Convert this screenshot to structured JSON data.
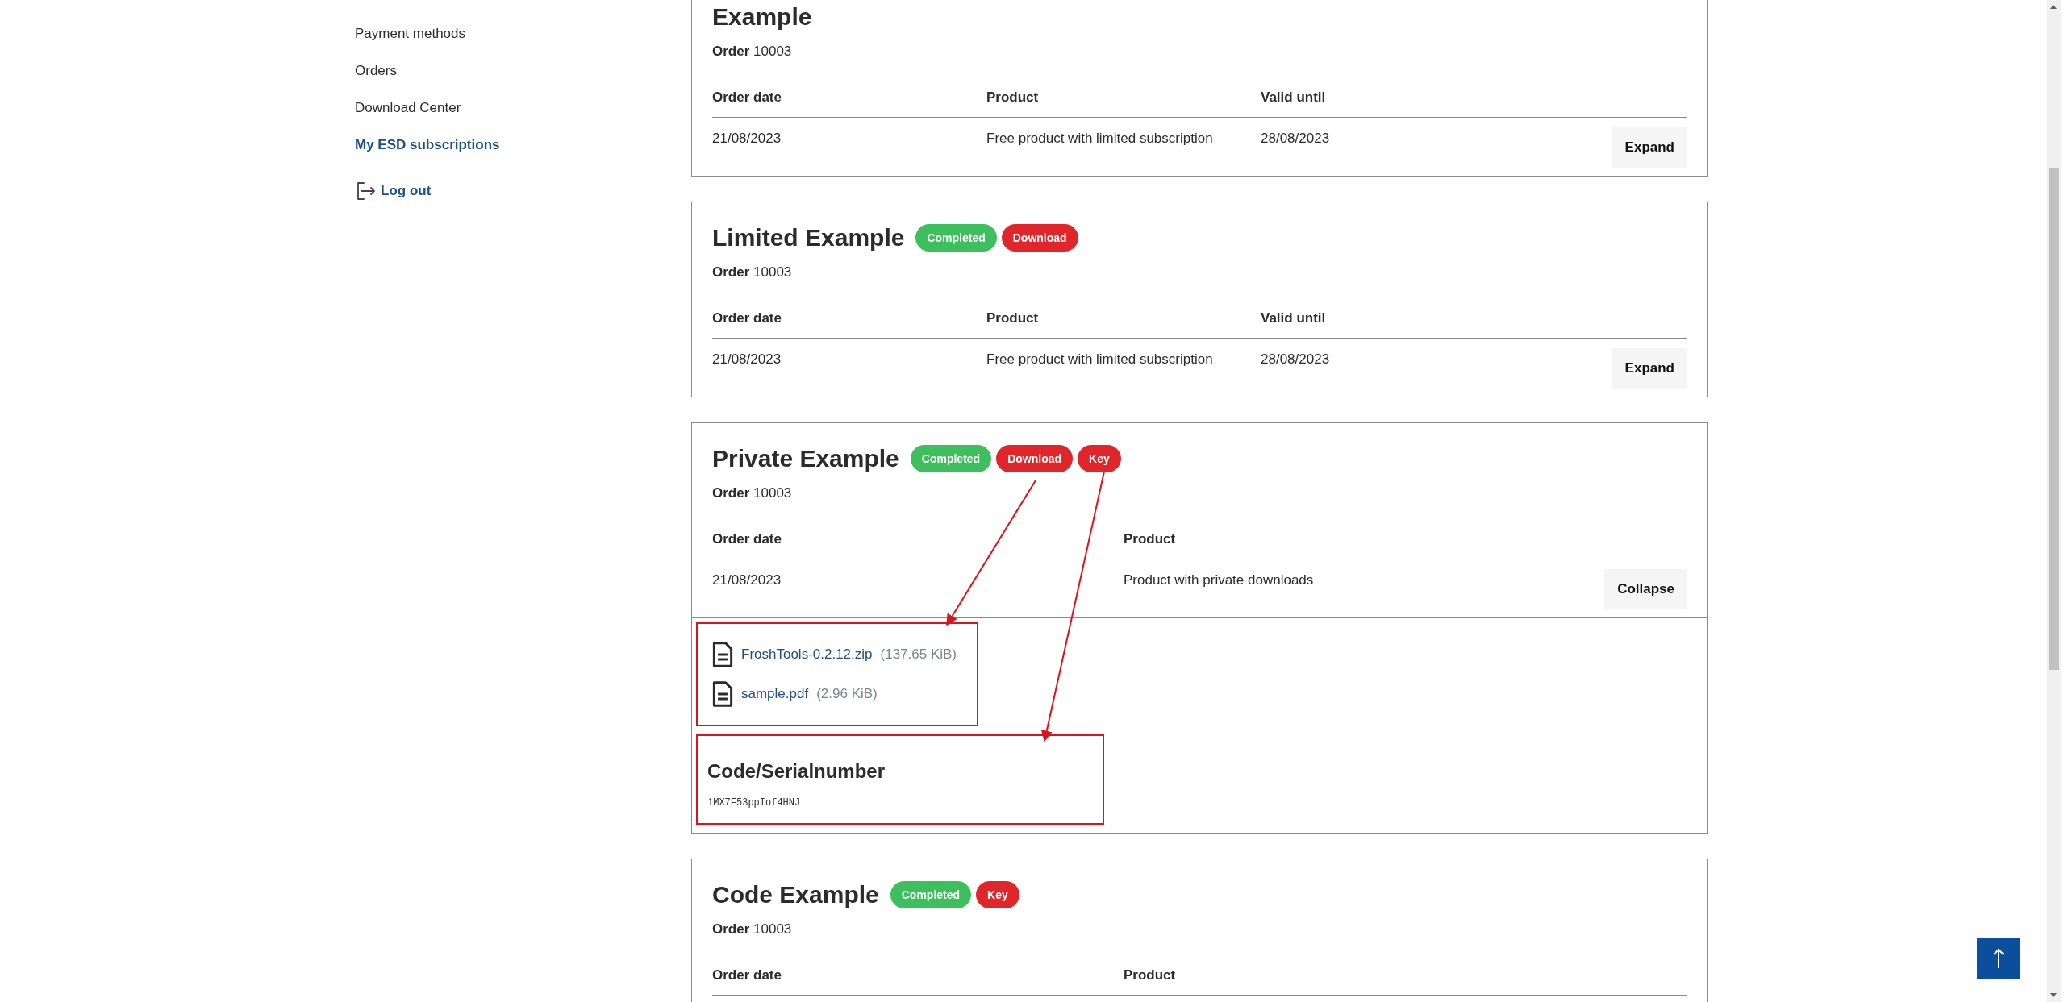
{
  "sidebar": {
    "items": [
      {
        "label": "Payment methods",
        "selected": false
      },
      {
        "label": "Orders",
        "selected": false
      },
      {
        "label": "Download Center",
        "selected": false
      },
      {
        "label": "My ESD subscriptions",
        "selected": true
      }
    ],
    "logout": {
      "label": "Log out"
    }
  },
  "subscriptions": [
    {
      "title": "Example",
      "order": "**Order** 10003",
      "columns": [
        "Order date",
        "Product",
        "Valid until"
      ],
      "row": [
        "21/08/2023",
        "Free product with limited subscription",
        "28/08/2023"
      ],
      "toggle": "Expand"
    },
    {
      "title": "Limited Example",
      "badges": [
        {
          "label": "Completed",
          "color": "#3cbf5c"
        },
        {
          "label": "Download",
          "color": "#e0262b"
        }
      ],
      "order": "**Order** 10003",
      "columns": [
        "Order date",
        "Product",
        "Valid until"
      ],
      "row": [
        "21/08/2023",
        "Free product with limited subscription",
        "28/08/2023"
      ],
      "toggle": "Expand"
    },
    {
      "title": "Private Example",
      "badges": [
        {
          "label": "Completed",
          "color": "#3cbf5c"
        },
        {
          "label": "Download",
          "color": "#e0262b"
        },
        {
          "label": "Key",
          "color": "#e0262b"
        }
      ],
      "order": "**Order** 10003",
      "columns": [
        "Order date",
        "Product"
      ],
      "row": [
        "21/08/2023",
        "Product with private downloads"
      ],
      "toggle": "Collapse",
      "expanded": true,
      "downloads": {
        "highlighted": true,
        "files": [
          {
            "name": "FroshTools-0.2.12.zip",
            "size": "(137.65 KiB)"
          },
          {
            "name": "sample.pdf",
            "size": "(2.96 KiB)"
          }
        ]
      },
      "code": {
        "highlighted": true,
        "heading": "Code/Serialnumber",
        "value": "1MX7F53ppIof4HNJ"
      }
    },
    {
      "title": "Code Example",
      "badges": [
        {
          "label": "Completed",
          "color": "#3cbf5c"
        },
        {
          "label": "Key",
          "color": "#e0262b"
        }
      ],
      "order": "**Order** 10003",
      "columns": [
        "Order date",
        "Product"
      ]
    }
  ]
}
